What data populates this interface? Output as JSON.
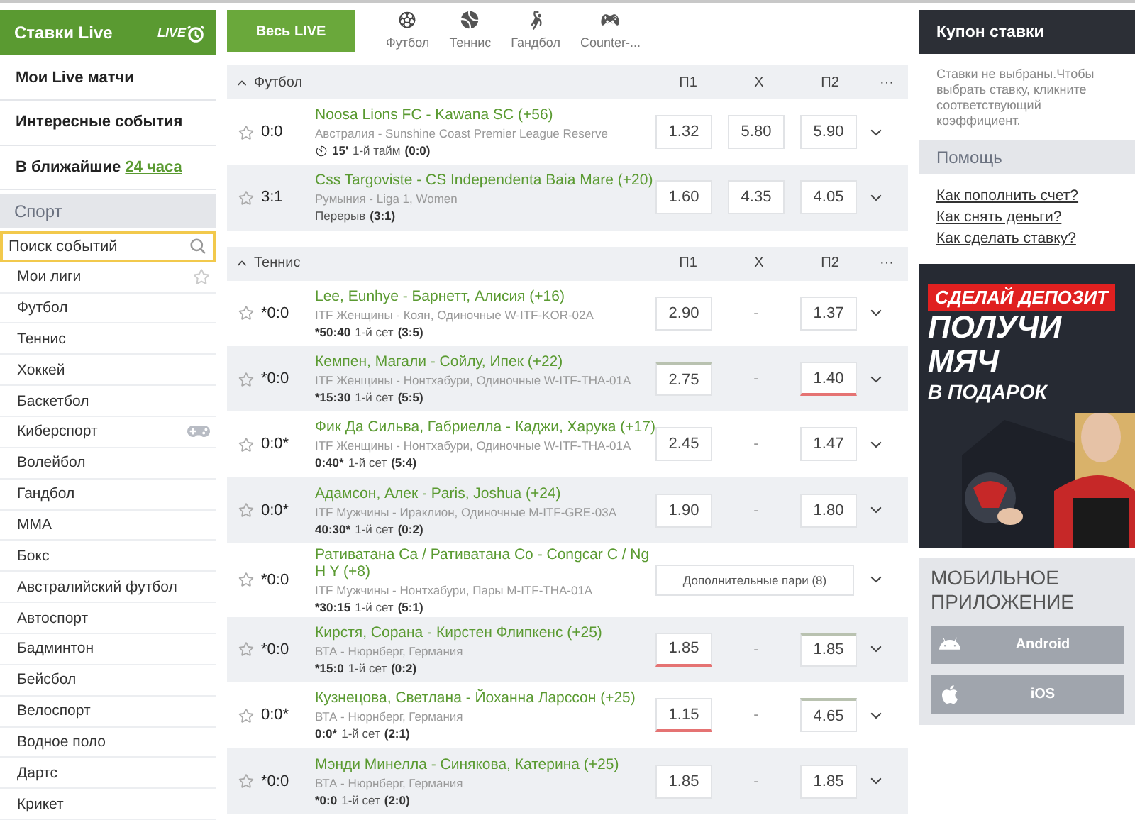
{
  "header": {
    "title": "Ставки Live",
    "live_badge": "LIVE",
    "all_live": "Весь LIVE",
    "sports": [
      {
        "label": "Футбол",
        "kind": "football"
      },
      {
        "label": "Теннис",
        "kind": "tennis"
      },
      {
        "label": "Гандбол",
        "kind": "handball"
      },
      {
        "label": "Counter-...",
        "kind": "esports"
      }
    ]
  },
  "left_menu": [
    {
      "text": "Мои Live матчи"
    },
    {
      "text": "Интересные события"
    },
    {
      "text": "В ближайшие",
      "link": "24 часа"
    }
  ],
  "sport_heading": "Спорт",
  "search": {
    "placeholder": "Поиск событий"
  },
  "sports": [
    {
      "label": "Мои лиги",
      "kind": "star"
    },
    {
      "label": "Футбол"
    },
    {
      "label": "Теннис"
    },
    {
      "label": "Хоккей"
    },
    {
      "label": "Баскетбол"
    },
    {
      "label": "Киберспорт",
      "kind": "gamepad"
    },
    {
      "label": "Волейбол"
    },
    {
      "label": "Гандбол"
    },
    {
      "label": "ММА"
    },
    {
      "label": "Бокс"
    },
    {
      "label": "Австралийский футбол"
    },
    {
      "label": "Автоспорт"
    },
    {
      "label": "Бадминтон"
    },
    {
      "label": "Бейсбол"
    },
    {
      "label": "Велоспорт"
    },
    {
      "label": "Водное поло"
    },
    {
      "label": "Дартс"
    },
    {
      "label": "Крикет"
    }
  ],
  "sections": [
    {
      "name": "Футбол",
      "expanded": true,
      "columns": [
        "П1",
        "Х",
        "П2"
      ],
      "more": "···",
      "events": [
        {
          "score": "0:0",
          "title": "Noosa Lions FC - Kawana SC (+56)",
          "league": "Австралия - Sunshine Coast Premier League Reserve",
          "timer": true,
          "clock": "15'",
          "period": "1-й тайм",
          "period_score": "(0:0)",
          "odds": [
            {
              "kind": "odd",
              "value": "1.32"
            },
            {
              "kind": "odd",
              "value": "5.80"
            },
            {
              "kind": "odd",
              "value": "5.90"
            }
          ]
        },
        {
          "score": "3:1",
          "title": "Css Targoviste - CS Independenta Baia Mare (+20)",
          "league": "Румыния - Liga 1, Women",
          "period": "Перерыв",
          "period_score": "(3:1)",
          "odds": [
            {
              "kind": "odd",
              "value": "1.60"
            },
            {
              "kind": "odd",
              "value": "4.35"
            },
            {
              "kind": "odd",
              "value": "4.05"
            }
          ]
        }
      ]
    },
    {
      "name": "Теннис",
      "expanded": true,
      "columns": [
        "П1",
        "Х",
        "П2"
      ],
      "more": "···",
      "events": [
        {
          "score": "*0:0",
          "title": "Lee, Eunhye - Барнетт, Алисия (+16)",
          "league": "ITF Женщины - Коян, Одиночные W-ITF-KOR-02A",
          "clock": "*50:40",
          "period": "1-й сет",
          "period_score": "(3:5)",
          "odds": [
            {
              "kind": "odd",
              "value": "2.90"
            },
            {
              "kind": "dash",
              "value": "-"
            },
            {
              "kind": "odd",
              "value": "1.37"
            }
          ]
        },
        {
          "score": "*0:0",
          "title": "Кемпен, Магали - Сойлу, Ипек (+22)",
          "league": "ITF Женщины - Нонтхабури, Одиночные W-ITF-THA-01A",
          "clock": "*15:30",
          "period": "1-й сет",
          "period_score": "(5:5)",
          "odds": [
            {
              "kind": "odd",
              "value": "2.75",
              "up": true
            },
            {
              "kind": "dash",
              "value": "-"
            },
            {
              "kind": "odd",
              "value": "1.40",
              "down": true
            }
          ]
        },
        {
          "score": "0:0*",
          "title": "Фик Да Сильва, Габриелла - Каджи, Харука (+17)",
          "league": "ITF Женщины - Нонтхабури, Одиночные W-ITF-THA-01A",
          "clock": "0:40*",
          "period": "1-й сет",
          "period_score": "(5:4)",
          "odds": [
            {
              "kind": "odd",
              "value": "2.45"
            },
            {
              "kind": "dash",
              "value": "-"
            },
            {
              "kind": "odd",
              "value": "1.47"
            }
          ]
        },
        {
          "score": "0:0*",
          "title": "Адамсон, Алек - Paris, Joshua (+24)",
          "league": "ITF Мужчины - Ираклион, Одиночные M-ITF-GRE-03A",
          "clock": "40:30*",
          "period": "1-й сет",
          "period_score": "(0:2)",
          "odds": [
            {
              "kind": "odd",
              "value": "1.90"
            },
            {
              "kind": "dash",
              "value": "-"
            },
            {
              "kind": "odd",
              "value": "1.80"
            }
          ]
        },
        {
          "score": "*0:0",
          "title": "Ративатана Са / Ративатана Со - Congcar C / Ng H Y (+8)",
          "league": "ITF Мужчины - Нонтхабури, Пары M-ITF-THA-01A",
          "clock": "*30:15",
          "period": "1-й сет",
          "period_score": "(5:1)",
          "extra": "Дополнительные пари (8)"
        },
        {
          "score": "*0:0",
          "title": "Кирстя, Сорана - Кирстен Флипкенс (+25)",
          "league": "ВТА - Нюрнберг, Германия",
          "clock": "*15:0",
          "period": "1-й сет",
          "period_score": "(0:2)",
          "odds": [
            {
              "kind": "odd",
              "value": "1.85",
              "down": true
            },
            {
              "kind": "dash",
              "value": "-"
            },
            {
              "kind": "odd",
              "value": "1.85",
              "up": true
            }
          ]
        },
        {
          "score": "0:0*",
          "title": "Кузнецова, Светлана - Йоханна Ларссон (+25)",
          "league": "ВТА - Нюрнберг, Германия",
          "clock": "0:0*",
          "period": "1-й сет",
          "period_score": "(2:1)",
          "odds": [
            {
              "kind": "odd",
              "value": "1.15",
              "down": true
            },
            {
              "kind": "dash",
              "value": "-"
            },
            {
              "kind": "odd",
              "value": "4.65",
              "up": true
            }
          ]
        },
        {
          "score": "*0:0",
          "title": "Мэнди Минелла - Синякова, Катерина (+25)",
          "league": "ВТА - Нюрнберг, Германия",
          "clock": "*0:0",
          "period": "1-й сет",
          "period_score": "(2:0)",
          "odds": [
            {
              "kind": "odd",
              "value": "1.85"
            },
            {
              "kind": "dash",
              "value": "-"
            },
            {
              "kind": "odd",
              "value": "1.85"
            }
          ]
        }
      ]
    }
  ],
  "coupon": {
    "title": "Купон ставки",
    "text": "Ставки не выбраны.Чтобы выбрать ставку, кликните соответствующий коэффициент."
  },
  "help": {
    "title": "Помощь",
    "links": [
      "Как пополнить счет?",
      "Как снять деньги?",
      "Как сделать ставку?"
    ]
  },
  "banner": {
    "tag": "СДЕЛАЙ ДЕПОЗИТ",
    "lines": [
      "ПОЛУЧИ",
      "МЯЧ",
      "В ПОДАРОК"
    ]
  },
  "mobile": {
    "title": "МОБИЛЬНОЕ ПРИЛОЖЕНИЕ",
    "buttons": [
      {
        "label": "Android",
        "kind": "android"
      },
      {
        "label": "iOS",
        "kind": "apple"
      }
    ]
  }
}
